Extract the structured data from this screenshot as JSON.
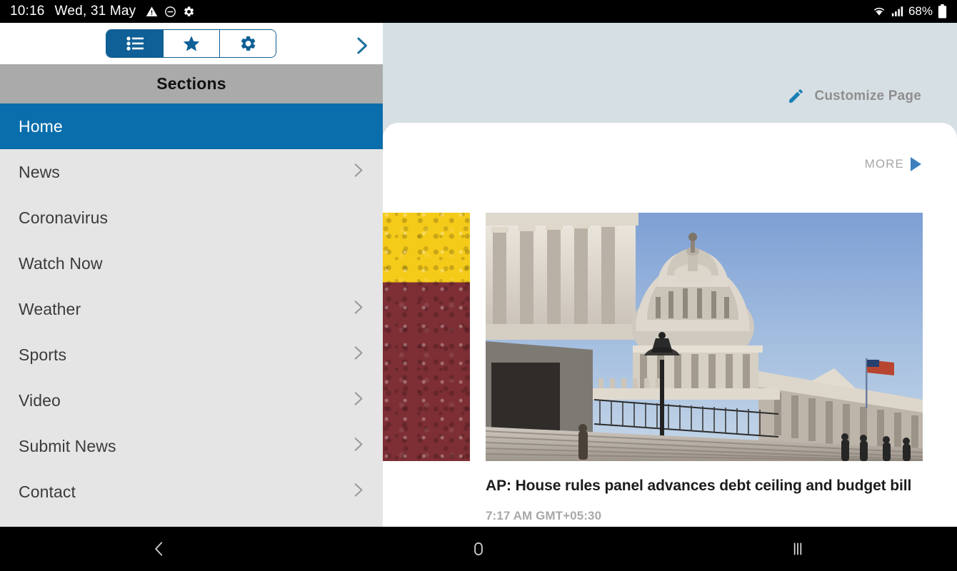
{
  "status_bar": {
    "time": "10:16",
    "date": "Wed, 31 May",
    "battery": "68%",
    "icons": [
      "warning-triangle-icon",
      "do-not-disturb-icon",
      "gear-icon",
      "wifi-icon",
      "cellular-signal-icon",
      "battery-icon"
    ]
  },
  "drawer": {
    "segmented_control": {
      "options": [
        "list-icon",
        "star-icon",
        "gear-icon"
      ],
      "selected_index": 0
    },
    "collapse_arrow": "chevron-right-icon",
    "sections_title": "Sections",
    "items": [
      {
        "label": "Home",
        "selected": true,
        "chevron": false
      },
      {
        "label": "News",
        "selected": false,
        "chevron": true
      },
      {
        "label": "Coronavirus",
        "selected": false,
        "chevron": false
      },
      {
        "label": "Watch Now",
        "selected": false,
        "chevron": false
      },
      {
        "label": "Weather",
        "selected": false,
        "chevron": true
      },
      {
        "label": "Sports",
        "selected": false,
        "chevron": true
      },
      {
        "label": "Video",
        "selected": false,
        "chevron": true
      },
      {
        "label": "Submit News",
        "selected": false,
        "chevron": true
      },
      {
        "label": "Contact",
        "selected": false,
        "chevron": true
      }
    ]
  },
  "main": {
    "customize": {
      "label": "Customize Page",
      "icon": "pencil-icon"
    },
    "more": {
      "label": "MORE",
      "icon": "play-triangle-icon"
    },
    "featured_article": {
      "headline": "AP: House rules panel advances debt ceiling and budget bill",
      "timestamp": "7:17 AM GMT+05:30",
      "image_alt": "us-capitol-building"
    },
    "adjacent_thumbnail_alt": "spices-yellow-maroon"
  },
  "navigation_bar": {
    "back": "back-chevron-icon",
    "home": "home-icon",
    "recents": "recents-icon"
  },
  "colors": {
    "accent_blue": "#0a6eac",
    "segment_blue": "#0f6096",
    "page_background": "#d6dfe3",
    "drawer_background": "#e5e5e5",
    "sections_header": "#aaaaaa",
    "more_arrow": "#3d80bd"
  }
}
